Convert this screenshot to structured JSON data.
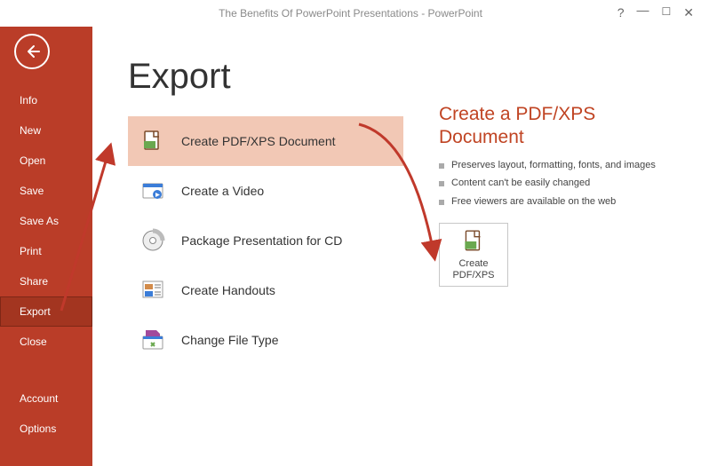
{
  "window": {
    "title": "The Benefits Of PowerPoint Presentations - PowerPoint"
  },
  "sidebar": {
    "items": [
      {
        "label": "Info"
      },
      {
        "label": "New"
      },
      {
        "label": "Open"
      },
      {
        "label": "Save"
      },
      {
        "label": "Save As"
      },
      {
        "label": "Print"
      },
      {
        "label": "Share"
      },
      {
        "label": "Export",
        "selected": true
      },
      {
        "label": "Close"
      }
    ],
    "footer_items": [
      {
        "label": "Account"
      },
      {
        "label": "Options"
      }
    ]
  },
  "page": {
    "title": "Export",
    "options": [
      {
        "label": "Create PDF/XPS Document",
        "icon": "pdf",
        "selected": true
      },
      {
        "label": "Create a Video",
        "icon": "video"
      },
      {
        "label": "Package Presentation for CD",
        "icon": "cd"
      },
      {
        "label": "Create Handouts",
        "icon": "handouts"
      },
      {
        "label": "Change File Type",
        "icon": "filetype"
      }
    ]
  },
  "detail": {
    "heading": "Create a PDF/XPS Document",
    "bullets": [
      "Preserves layout, formatting, fonts, and images",
      "Content can't be easily changed",
      "Free viewers are available on the web"
    ],
    "action_label_line1": "Create",
    "action_label_line2": "PDF/XPS"
  }
}
